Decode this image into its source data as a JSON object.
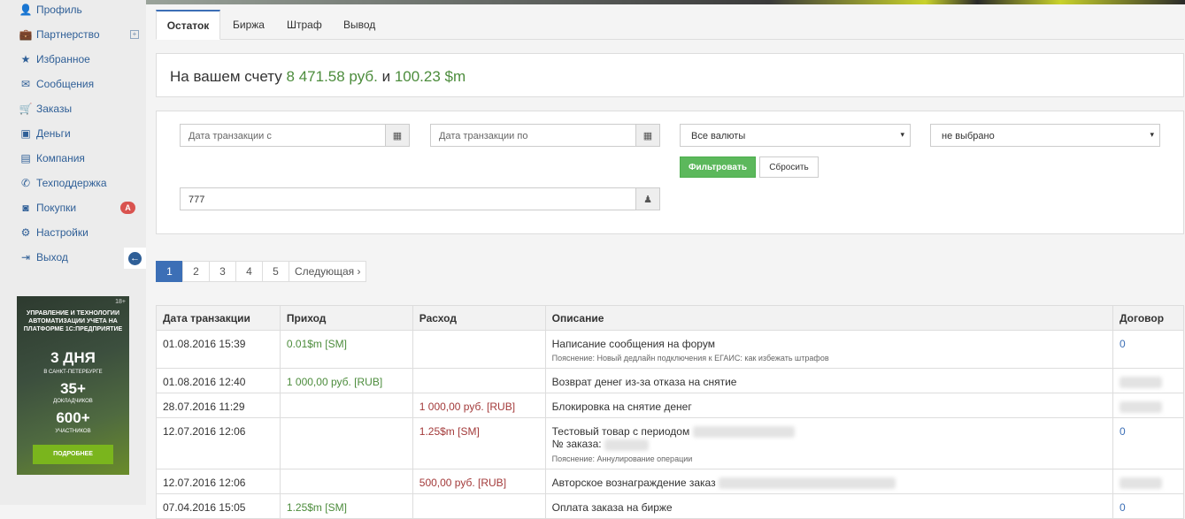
{
  "sidebar": {
    "items": [
      {
        "label": "Профиль",
        "icon": "user-icon",
        "glyph": "👤"
      },
      {
        "label": "Партнерство",
        "icon": "briefcase-icon",
        "glyph": "💼"
      },
      {
        "label": "Избранное",
        "icon": "star-icon",
        "glyph": "★"
      },
      {
        "label": "Сообщения",
        "icon": "envelope-icon",
        "glyph": "✉"
      },
      {
        "label": "Заказы",
        "icon": "cart-icon",
        "glyph": "🛒"
      },
      {
        "label": "Деньги",
        "icon": "money-icon",
        "glyph": "▣"
      },
      {
        "label": "Компания",
        "icon": "building-icon",
        "glyph": "▤"
      },
      {
        "label": "Техподдержка",
        "icon": "phone-icon",
        "glyph": "✆"
      },
      {
        "label": "Покупки",
        "icon": "shopping-bag-icon",
        "glyph": "◙"
      },
      {
        "label": "Настройки",
        "icon": "gear-icon",
        "glyph": "⚙"
      },
      {
        "label": "Выход",
        "icon": "sign-out-icon",
        "glyph": "⇥"
      }
    ],
    "plus": "+",
    "badge": "A",
    "collapse_glyph": "←"
  },
  "ad": {
    "age": "18+",
    "line1": "УПРАВЛЕНИЕ И ТЕХНОЛОГИИ АВТОМАТИЗАЦИИ УЧЕТА НА ПЛАТФОРМЕ 1С:ПРЕДПРИЯТИЕ",
    "days": "3 ДНЯ",
    "city": "В САНКТ-ПЕТЕРБУРГЕ",
    "speakers_num": "35+",
    "speakers_lbl": "ДОКЛАДЧИКОВ",
    "participants_num": "600+",
    "participants_lbl": "УЧАСТНИКОВ",
    "more": "ПОДРОБНЕЕ"
  },
  "tabs": [
    "Остаток",
    "Биржа",
    "Штраф",
    "Вывод"
  ],
  "balance": {
    "prefix": "На вашем счету",
    "rub": "8 471.58 руб.",
    "and": "и",
    "sm": "100.23 $m"
  },
  "filter": {
    "date_from_placeholder": "Дата транзакции с",
    "date_to_placeholder": "Дата транзакции по",
    "currency_value": "Все валюты",
    "type_value": "не выбрано",
    "filter_button": "Фильтровать",
    "reset_button": "Сбросить",
    "user_value": "777"
  },
  "pagination": [
    "1",
    "2",
    "3",
    "4",
    "5",
    "Следующая ›"
  ],
  "table": {
    "headers": [
      "Дата транзакции",
      "Приход",
      "Расход",
      "Описание",
      "Договор"
    ],
    "rows": [
      {
        "date": "01.08.2016 15:39",
        "income": "0.01$m [SM]",
        "expense": "",
        "desc": "Написание сообщения на форум",
        "desc2": "",
        "note": "Пояснение: Новый дедлайн подключения к ЕГАИС: как избежать штрафов",
        "contract": "0"
      },
      {
        "date": "01.08.2016 12:40",
        "income": "1 000,00 руб. [RUB]",
        "expense": "",
        "desc": "Возврат денег из-за отказа на снятие",
        "desc2": "",
        "note": "",
        "contract": ""
      },
      {
        "date": "28.07.2016 11:29",
        "income": "",
        "expense": "1 000,00 руб. [RUB]",
        "desc": "Блокировка на снятие денег",
        "desc2": "",
        "note": "",
        "contract": ""
      },
      {
        "date": "12.07.2016 12:06",
        "income": "",
        "expense": "1.25$m [SM]",
        "desc": "Тестовый товар с периодом",
        "desc2": "№ заказа:",
        "note": "Пояснение: Аннулирование операции",
        "contract": "0"
      },
      {
        "date": "12.07.2016 12:06",
        "income": "",
        "expense": "500,00 руб. [RUB]",
        "desc": "Авторское вознаграждение заказ",
        "desc2": "",
        "note": "",
        "contract": ""
      },
      {
        "date": "07.04.2016 15:05",
        "income": "1.25$m [SM]",
        "expense": "",
        "desc": "Оплата заказа на бирже",
        "desc2": "",
        "note": "",
        "contract": "0"
      }
    ]
  },
  "colors": {
    "accent": "#3c6fb6",
    "green": "#5cb85c",
    "income": "#4c8c3c",
    "expense": "#a33a3a",
    "badge": "#d9534f"
  }
}
